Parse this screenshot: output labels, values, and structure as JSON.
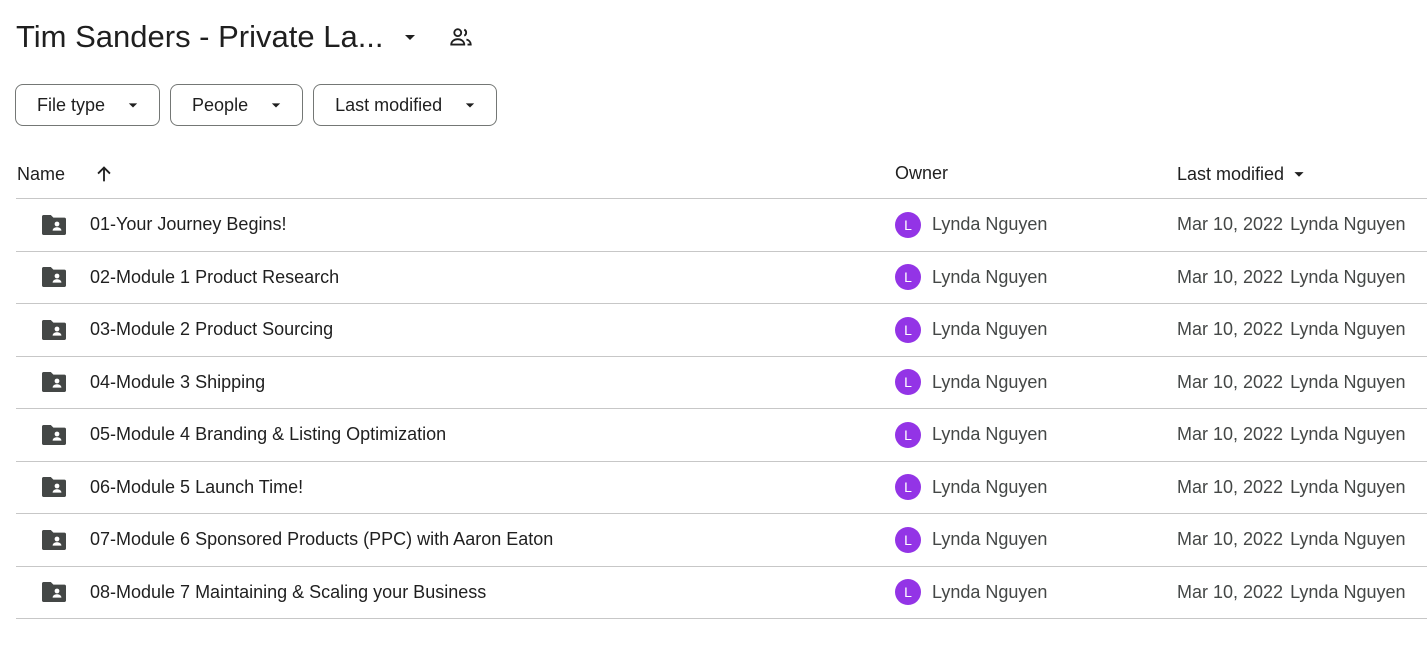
{
  "header": {
    "title": "Tim Sanders - Private La...",
    "icons": {
      "caret": "arrow-drop-down-icon",
      "shared": "shared-people-icon"
    }
  },
  "filters": [
    {
      "label": "File type"
    },
    {
      "label": "People"
    },
    {
      "label": "Last modified"
    }
  ],
  "table": {
    "columns": {
      "name": "Name",
      "owner": "Owner",
      "modified": "Last modified"
    },
    "rows": [
      {
        "name": "01-Your Journey Begins!",
        "owner_initial": "L",
        "owner": "Lynda Nguyen",
        "date": "Mar 10, 2022",
        "modified_by": "Lynda Nguyen"
      },
      {
        "name": "02-Module 1 Product Research",
        "owner_initial": "L",
        "owner": "Lynda Nguyen",
        "date": "Mar 10, 2022",
        "modified_by": "Lynda Nguyen"
      },
      {
        "name": "03-Module 2 Product Sourcing",
        "owner_initial": "L",
        "owner": "Lynda Nguyen",
        "date": "Mar 10, 2022",
        "modified_by": "Lynda Nguyen"
      },
      {
        "name": "04-Module 3 Shipping",
        "owner_initial": "L",
        "owner": "Lynda Nguyen",
        "date": "Mar 10, 2022",
        "modified_by": "Lynda Nguyen"
      },
      {
        "name": "05-Module 4 Branding & Listing Optimization",
        "owner_initial": "L",
        "owner": "Lynda Nguyen",
        "date": "Mar 10, 2022",
        "modified_by": "Lynda Nguyen"
      },
      {
        "name": "06-Module 5 Launch Time!",
        "owner_initial": "L",
        "owner": "Lynda Nguyen",
        "date": "Mar 10, 2022",
        "modified_by": "Lynda Nguyen"
      },
      {
        "name": "07-Module 6 Sponsored Products (PPC) with Aaron Eaton",
        "owner_initial": "L",
        "owner": "Lynda Nguyen",
        "date": "Mar 10, 2022",
        "modified_by": "Lynda Nguyen"
      },
      {
        "name": "08-Module 7 Maintaining & Scaling your Business",
        "owner_initial": "L",
        "owner": "Lynda Nguyen",
        "date": "Mar 10, 2022",
        "modified_by": "Lynda Nguyen"
      }
    ]
  },
  "colors": {
    "avatar": "#9334e6",
    "border": "#c7c7c7",
    "icon": "#444746"
  }
}
